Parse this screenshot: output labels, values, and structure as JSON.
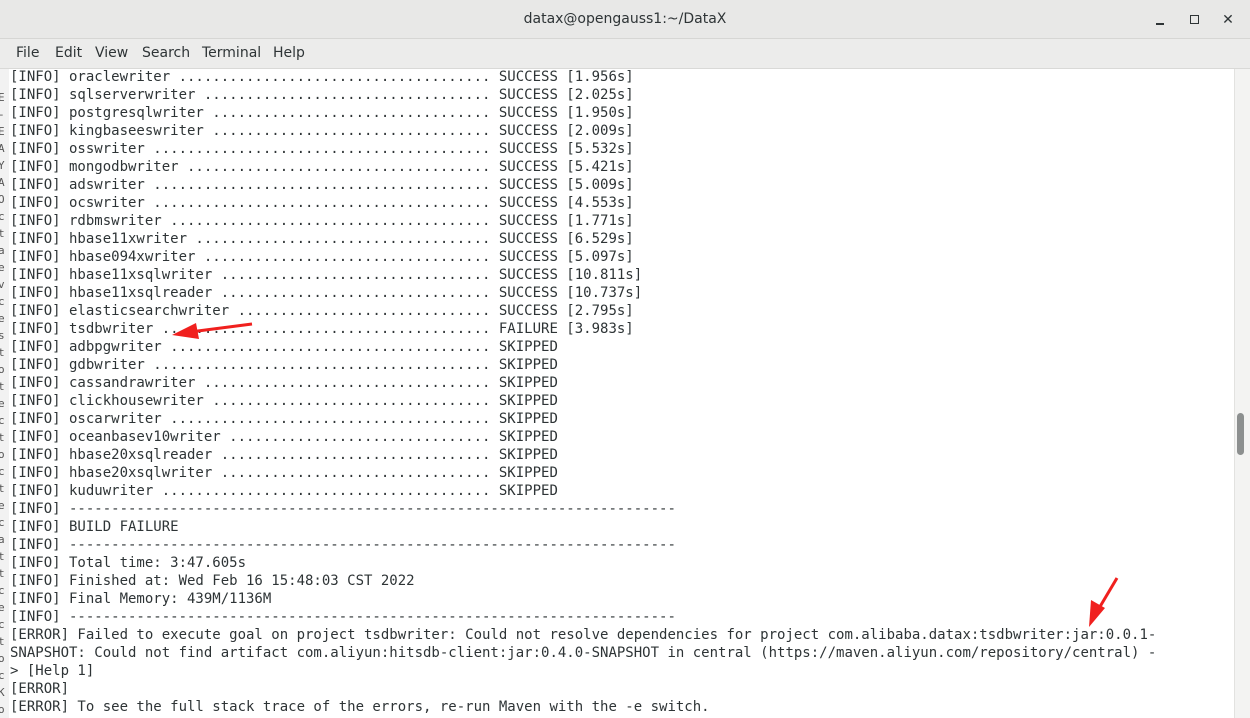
{
  "window": {
    "title": "datax@opengauss1:~/DataX",
    "minimize_glyph": "✕",
    "close_glyph": "✕"
  },
  "menu": [
    "File",
    "Edit",
    "View",
    "Search",
    "Terminal",
    "Help"
  ],
  "left_strip_glyphs": [
    "E",
    "-",
    "E",
    "A",
    "Y",
    "A",
    "O",
    "c",
    "t",
    "a",
    "e",
    "v",
    "c",
    "e",
    "s",
    "t",
    "o",
    "t",
    "e",
    "c",
    "t",
    "o",
    "c",
    "t",
    "e",
    "c",
    "a",
    "t",
    "t",
    "c",
    "e",
    "c",
    "t",
    "o",
    "c",
    "K",
    "o"
  ],
  "terminal_lines": [
    "[INFO] oraclewriter ..................................... SUCCESS [1.956s]",
    "[INFO] sqlserverwriter .................................. SUCCESS [2.025s]",
    "[INFO] postgresqlwriter ................................. SUCCESS [1.950s]",
    "[INFO] kingbaseeswriter ................................. SUCCESS [2.009s]",
    "[INFO] osswriter ........................................ SUCCESS [5.532s]",
    "[INFO] mongodbwriter .................................... SUCCESS [5.421s]",
    "[INFO] adswriter ........................................ SUCCESS [5.009s]",
    "[INFO] ocswriter ........................................ SUCCESS [4.553s]",
    "[INFO] rdbmswriter ...................................... SUCCESS [1.771s]",
    "[INFO] hbase11xwriter ................................... SUCCESS [6.529s]",
    "[INFO] hbase094xwriter .................................. SUCCESS [5.097s]",
    "[INFO] hbase11xsqlwriter ................................ SUCCESS [10.811s]",
    "[INFO] hbase11xsqlreader ................................ SUCCESS [10.737s]",
    "[INFO] elasticsearchwriter .............................. SUCCESS [2.795s]",
    "[INFO] tsdbwriter ....................................... FAILURE [3.983s]",
    "[INFO] adbpgwriter ...................................... SKIPPED",
    "[INFO] gdbwriter ........................................ SKIPPED",
    "[INFO] cassandrawriter .................................. SKIPPED",
    "[INFO] clickhousewriter ................................. SKIPPED",
    "[INFO] oscarwriter ...................................... SKIPPED",
    "[INFO] oceanbasev10writer ............................... SKIPPED",
    "[INFO] hbase20xsqlreader ................................ SKIPPED",
    "[INFO] hbase20xsqlwriter ................................ SKIPPED",
    "[INFO] kuduwriter ....................................... SKIPPED",
    "[INFO] ------------------------------------------------------------------------",
    "[INFO] BUILD FAILURE",
    "[INFO] ------------------------------------------------------------------------",
    "[INFO] Total time: 3:47.605s",
    "[INFO] Finished at: Wed Feb 16 15:48:03 CST 2022",
    "[INFO] Final Memory: 439M/1136M",
    "[INFO] ------------------------------------------------------------------------",
    "[ERROR] Failed to execute goal on project tsdbwriter: Could not resolve dependencies for project com.alibaba.datax:tsdbwriter:jar:0.0.1-",
    "SNAPSHOT: Could not find artifact com.aliyun:hitsdb-client:jar:0.4.0-SNAPSHOT in central (https://maven.aliyun.com/repository/central) -",
    "> [Help 1]",
    "[ERROR]",
    "[ERROR] To see the full stack trace of the errors, re-run Maven with the -e switch."
  ],
  "colors": {
    "annotation_arrow": "#f0201e",
    "terminal_text": "#2e3436"
  }
}
